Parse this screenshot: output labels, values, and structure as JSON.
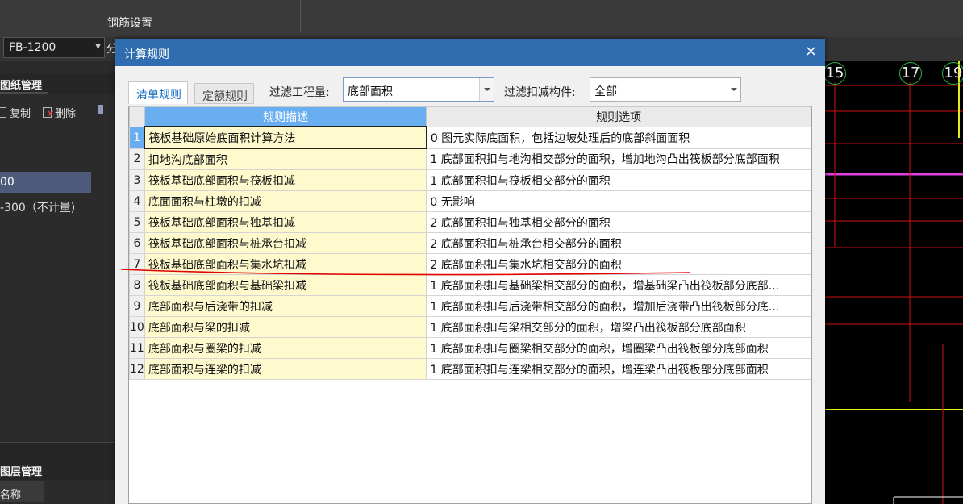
{
  "app": {
    "menu_label": "钢筋设置",
    "floor_combo": "FB-1200",
    "floor_combo_cut": "分",
    "drawing_panel": {
      "title": "图纸管理",
      "copy_label": "复制",
      "delete_label": "删除",
      "selected_item": "00",
      "item2": "-300（不计量)"
    },
    "layer_panel": {
      "title": "图层管理",
      "name_col": "名称"
    },
    "axis_labels": [
      "15",
      "17",
      "19"
    ]
  },
  "dialog": {
    "title": "计算规则",
    "close_label": "×",
    "tabs": [
      {
        "label": "清单规则",
        "active": true
      },
      {
        "label": "定额规则",
        "active": false
      }
    ],
    "filter_quantity_label": "过滤工程量:",
    "filter_quantity_value": "底部面积",
    "filter_component_label": "过滤扣减构件:",
    "filter_component_value": "全部",
    "columns": [
      "规则描述",
      "规则选项"
    ],
    "rows": [
      {
        "num": "1",
        "desc": "筏板基础原始底面积计算方法",
        "opt": "0 图元实际底面积，包括边坡处理后的底部斜面面积"
      },
      {
        "num": "2",
        "desc": "扣地沟底部面积",
        "opt": "1 底部面积扣与地沟相交部分的面积，增加地沟凸出筏板部分底部面积"
      },
      {
        "num": "3",
        "desc": "筏板基础底部面积与筏板扣减",
        "opt": "1 底部面积扣与筏板相交部分的面积"
      },
      {
        "num": "4",
        "desc": "底面面积与柱墩的扣减",
        "opt": "0  无影响"
      },
      {
        "num": "5",
        "desc": "筏板基础底部面积与独基扣减",
        "opt": "2 底部面积扣与独基相交部分的面积"
      },
      {
        "num": "6",
        "desc": "筏板基础底部面积与桩承台扣减",
        "opt": "2 底部面积扣与桩承台相交部分的面积"
      },
      {
        "num": "7",
        "desc": "筏板基础底部面积与集水坑扣减",
        "opt": "2 底部面积扣与集水坑相交部分的面积"
      },
      {
        "num": "8",
        "desc": "筏板基础底部面积与基础梁扣减",
        "opt": "1 底部面积扣与基础梁相交部分的面积，增基础梁凸出筏板部分底部..."
      },
      {
        "num": "9",
        "desc": "底部面积与后浇带的扣减",
        "opt": "1 底部面积扣与后浇带相交部分的面积，增加后浇带凸出筏板部分底..."
      },
      {
        "num": "10",
        "desc": "底部面积与梁的扣减",
        "opt": "1 底部面积扣与梁相交部分的面积，增梁凸出筏板部分底部面积"
      },
      {
        "num": "11",
        "desc": "底部面积与圈梁的扣减",
        "opt": "1 底部面积扣与圈梁相交部分的面积，增圈梁凸出筏板部分底部面积"
      },
      {
        "num": "12",
        "desc": "底部面积与连梁的扣减",
        "opt": "1 底部面积扣与连梁相交部分的面积，增连梁凸出筏板部分底部面积"
      }
    ]
  },
  "colors": {
    "title_bar": "#2f6cb0",
    "header_blue": "#68aef0",
    "desc_yellow": "#fefacd",
    "annotation_red": "#e00000",
    "axis_green": "#2fb24a"
  }
}
